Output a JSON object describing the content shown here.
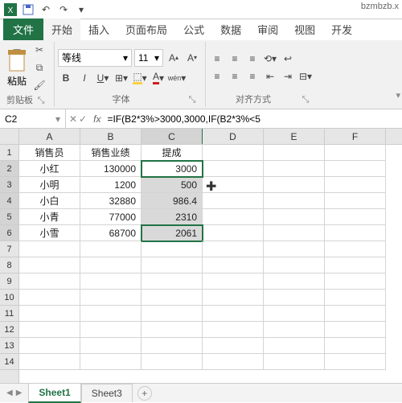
{
  "title_right": "bzmbzb.x",
  "tabs": {
    "file": "文件",
    "home": "开始",
    "insert": "插入",
    "layout": "页面布局",
    "formulas": "公式",
    "data": "数据",
    "review": "审阅",
    "view": "视图",
    "dev": "开发"
  },
  "ribbon": {
    "clipboard": {
      "name": "剪贴板",
      "paste": "粘贴"
    },
    "font": {
      "name": "字体",
      "font_name": "等线",
      "font_size": "11",
      "bold": "B",
      "italic": "I",
      "underline": "U",
      "wen": "wén"
    },
    "alignment": {
      "name": "对齐方式"
    }
  },
  "namebox": "C2",
  "formula": "=IF(B2*3%>3000,3000,IF(B2*3%<5",
  "columns": [
    "A",
    "B",
    "C",
    "D",
    "E",
    "F"
  ],
  "rows": [
    "1",
    "2",
    "3",
    "4",
    "5",
    "6",
    "7",
    "8",
    "9",
    "10",
    "11",
    "12",
    "13",
    "14"
  ],
  "data": {
    "headers": [
      "销售员",
      "销售业绩",
      "提成"
    ],
    "rows": [
      {
        "a": "小红",
        "b": "130000",
        "c": "3000"
      },
      {
        "a": "小明",
        "b": "1200",
        "c": "500"
      },
      {
        "a": "小白",
        "b": "32880",
        "c": "986.4"
      },
      {
        "a": "小青",
        "b": "77000",
        "c": "2310"
      },
      {
        "a": "小雪",
        "b": "68700",
        "c": "2061"
      }
    ]
  },
  "sheets": {
    "s1": "Sheet1",
    "s3": "Sheet3",
    "add": "+"
  },
  "chart_data": {
    "type": "table",
    "title": "",
    "columns": [
      "销售员",
      "销售业绩",
      "提成"
    ],
    "rows": [
      [
        "小红",
        130000,
        3000
      ],
      [
        "小明",
        1200,
        500
      ],
      [
        "小白",
        32880,
        986.4
      ],
      [
        "小青",
        77000,
        2310
      ],
      [
        "小雪",
        68700,
        2061
      ]
    ]
  }
}
